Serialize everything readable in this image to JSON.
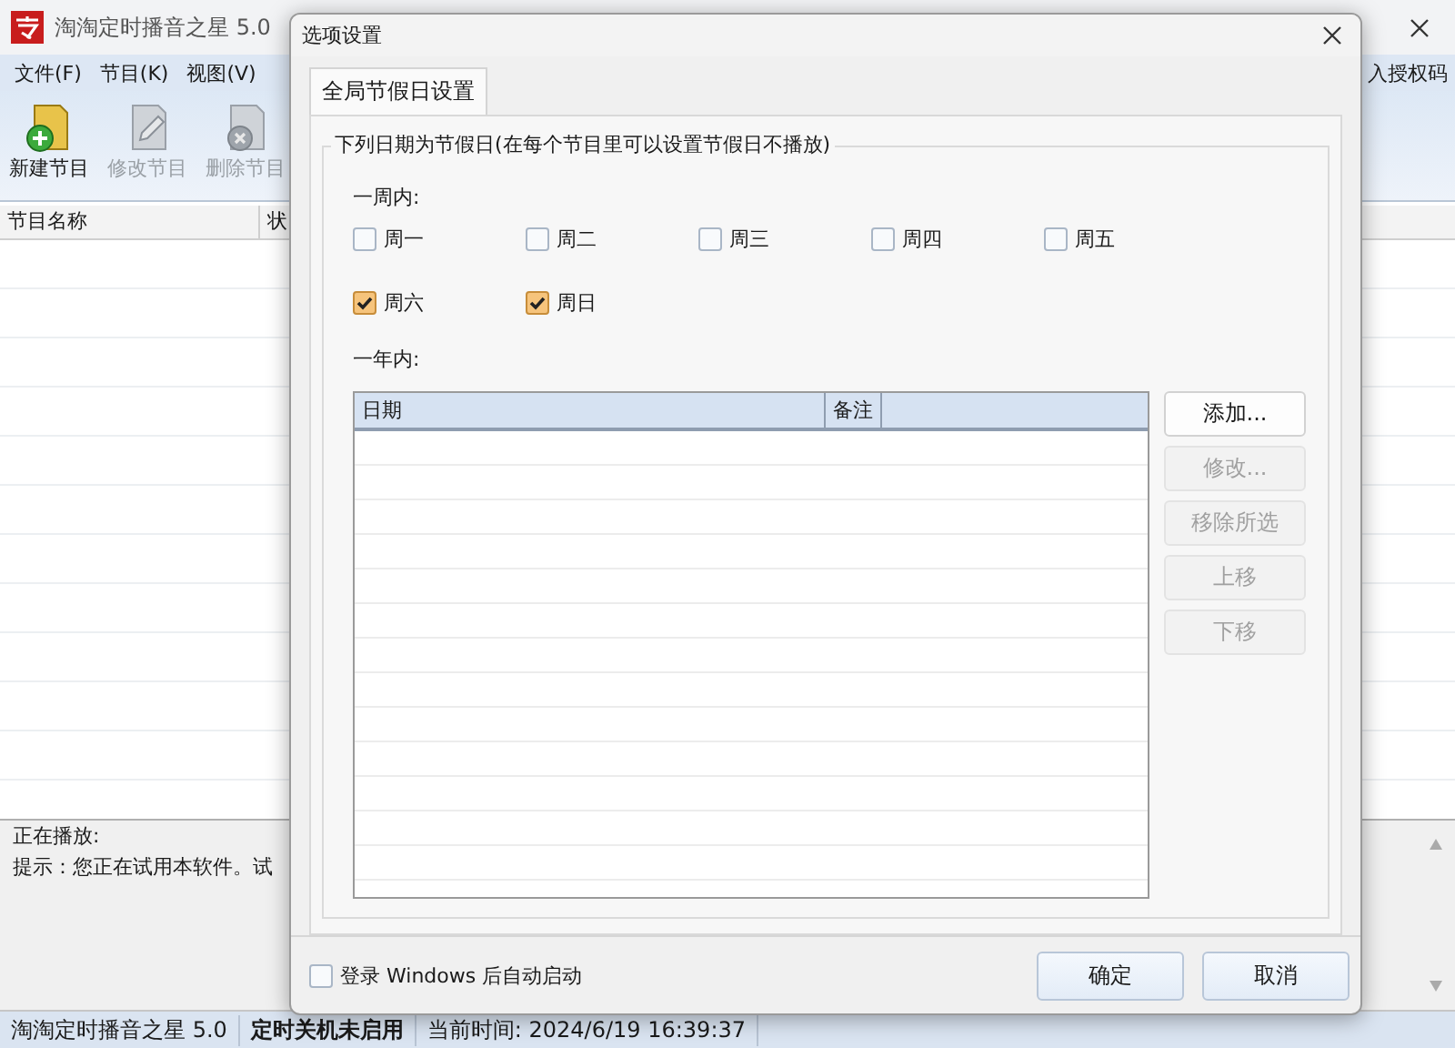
{
  "main_window": {
    "title": "淘淘定时播音之星 5.0",
    "menu": [
      "文件(F)",
      "节目(K)",
      "视图(V)"
    ],
    "license_link": "入授权码",
    "toolbar": [
      {
        "kind": "new",
        "label": "新建节目",
        "disabled": false
      },
      {
        "kind": "edit",
        "label": "修改节目",
        "disabled": true
      },
      {
        "kind": "delete",
        "label": "删除节目",
        "disabled": true
      }
    ],
    "list": {
      "columns": [
        "节目名称",
        "状"
      ]
    },
    "info": [
      "正在播放:",
      "提示：您正在试用本软件。试"
    ],
    "status_bar": [
      "淘淘定时播音之星 5.0",
      "定时关机未启用",
      "当前时间: 2024/6/19 16:39:37"
    ]
  },
  "dialog": {
    "title": "选项设置",
    "tabs": [
      {
        "label": "全局节假日设置",
        "selected": true
      }
    ],
    "group_title": "下列日期为节假日(在每个节目里可以设置节假日不播放)",
    "week_label": "一周内:",
    "weekdays": [
      {
        "label": "周一",
        "checked": false
      },
      {
        "label": "周二",
        "checked": false
      },
      {
        "label": "周三",
        "checked": false
      },
      {
        "label": "周四",
        "checked": false
      },
      {
        "label": "周五",
        "checked": false
      },
      {
        "label": "周六",
        "checked": true
      },
      {
        "label": "周日",
        "checked": true
      }
    ],
    "year_label": "一年内:",
    "table": {
      "columns": [
        "日期",
        "备注"
      ]
    },
    "buttons": [
      {
        "label": "添加...",
        "disabled": false
      },
      {
        "label": "修改...",
        "disabled": true
      },
      {
        "label": "移除所选",
        "disabled": true
      },
      {
        "label": "上移",
        "disabled": true
      },
      {
        "label": "下移",
        "disabled": true
      }
    ],
    "autostart": {
      "label": "登录 Windows 后自动启动",
      "checked": false
    },
    "actions": [
      "确定",
      "取消"
    ]
  }
}
